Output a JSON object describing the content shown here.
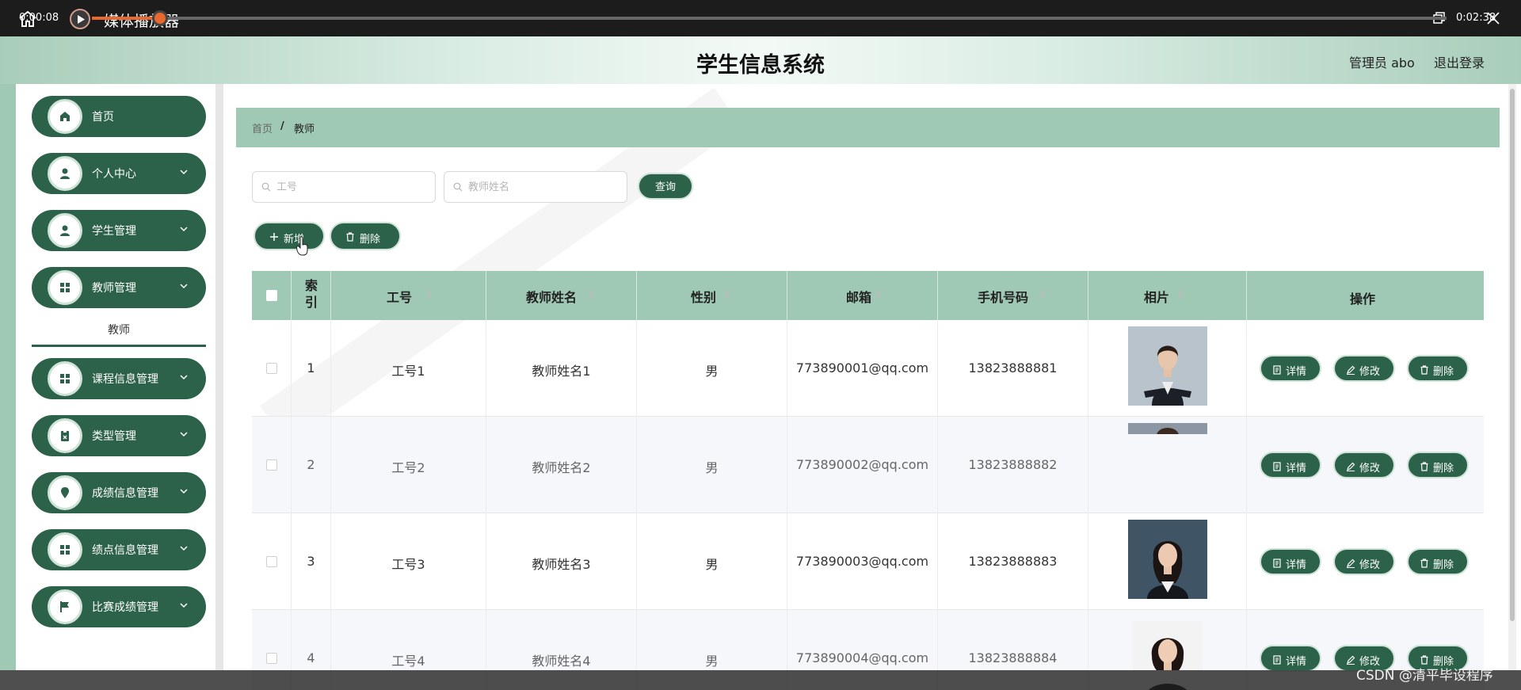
{
  "window": {
    "title": "媒体播放器",
    "icons": {
      "home": "home-icon",
      "app": "play-circle-icon",
      "minimize": "minimize-icon",
      "maximize": "restore-icon",
      "close": "close-icon"
    }
  },
  "header": {
    "title": "学生信息系统",
    "admin": "管理员 abo",
    "logout": "退出登录"
  },
  "sidebar": {
    "items": [
      {
        "label": "首页",
        "icon": "home-icon",
        "has_children": false
      },
      {
        "label": "个人中心",
        "icon": "user-icon",
        "has_children": true
      },
      {
        "label": "学生管理",
        "icon": "user-icon",
        "has_children": true
      },
      {
        "label": "教师管理",
        "icon": "grid-icon",
        "has_children": true,
        "expanded": true
      },
      {
        "label": "课程信息管理",
        "icon": "grid-icon",
        "has_children": true
      },
      {
        "label": "类型管理",
        "icon": "clipboard-icon",
        "has_children": true
      },
      {
        "label": "成绩信息管理",
        "icon": "pin-icon",
        "has_children": true
      },
      {
        "label": "绩点信息管理",
        "icon": "grid-icon",
        "has_children": true
      },
      {
        "label": "比赛成绩管理",
        "icon": "flag-icon",
        "has_children": true
      }
    ],
    "submenu": {
      "label": "教师"
    }
  },
  "breadcrumb": {
    "home": "首页",
    "separator": "/",
    "current": "教师"
  },
  "search": {
    "job_no_placeholder": "工号",
    "teacher_name_placeholder": "教师姓名",
    "query_label": "查询"
  },
  "toolbar": {
    "add_label": "新增",
    "delete_label": "删除"
  },
  "table": {
    "columns": [
      "索引",
      "工号",
      "教师姓名",
      "性别",
      "邮箱",
      "手机号码",
      "相片",
      "操作"
    ],
    "rows": [
      {
        "index": "1",
        "job_no": "工号1",
        "name": "教师姓名1",
        "gender": "男",
        "email": "773890001@qq.com",
        "phone": "13823888881"
      },
      {
        "index": "2",
        "job_no": "工号2",
        "name": "教师姓名2",
        "gender": "男",
        "email": "773890002@qq.com",
        "phone": "13823888882"
      },
      {
        "index": "3",
        "job_no": "工号3",
        "name": "教师姓名3",
        "gender": "男",
        "email": "773890003@qq.com",
        "phone": "13823888883"
      },
      {
        "index": "4",
        "job_no": "工号4",
        "name": "教师姓名4",
        "gender": "男",
        "email": "773890004@qq.com",
        "phone": "13823888884"
      }
    ],
    "actions": {
      "detail": "详情",
      "edit": "修改",
      "delete": "删除"
    }
  },
  "player": {
    "elapsed": "0:00:08",
    "duration": "0:02:38",
    "progress": 0.05,
    "watermark": "CSDN @清平毕设程序"
  },
  "colors": {
    "primary": "#2c6249",
    "accent": "#9fc9b4",
    "progress": "#e8692b"
  }
}
